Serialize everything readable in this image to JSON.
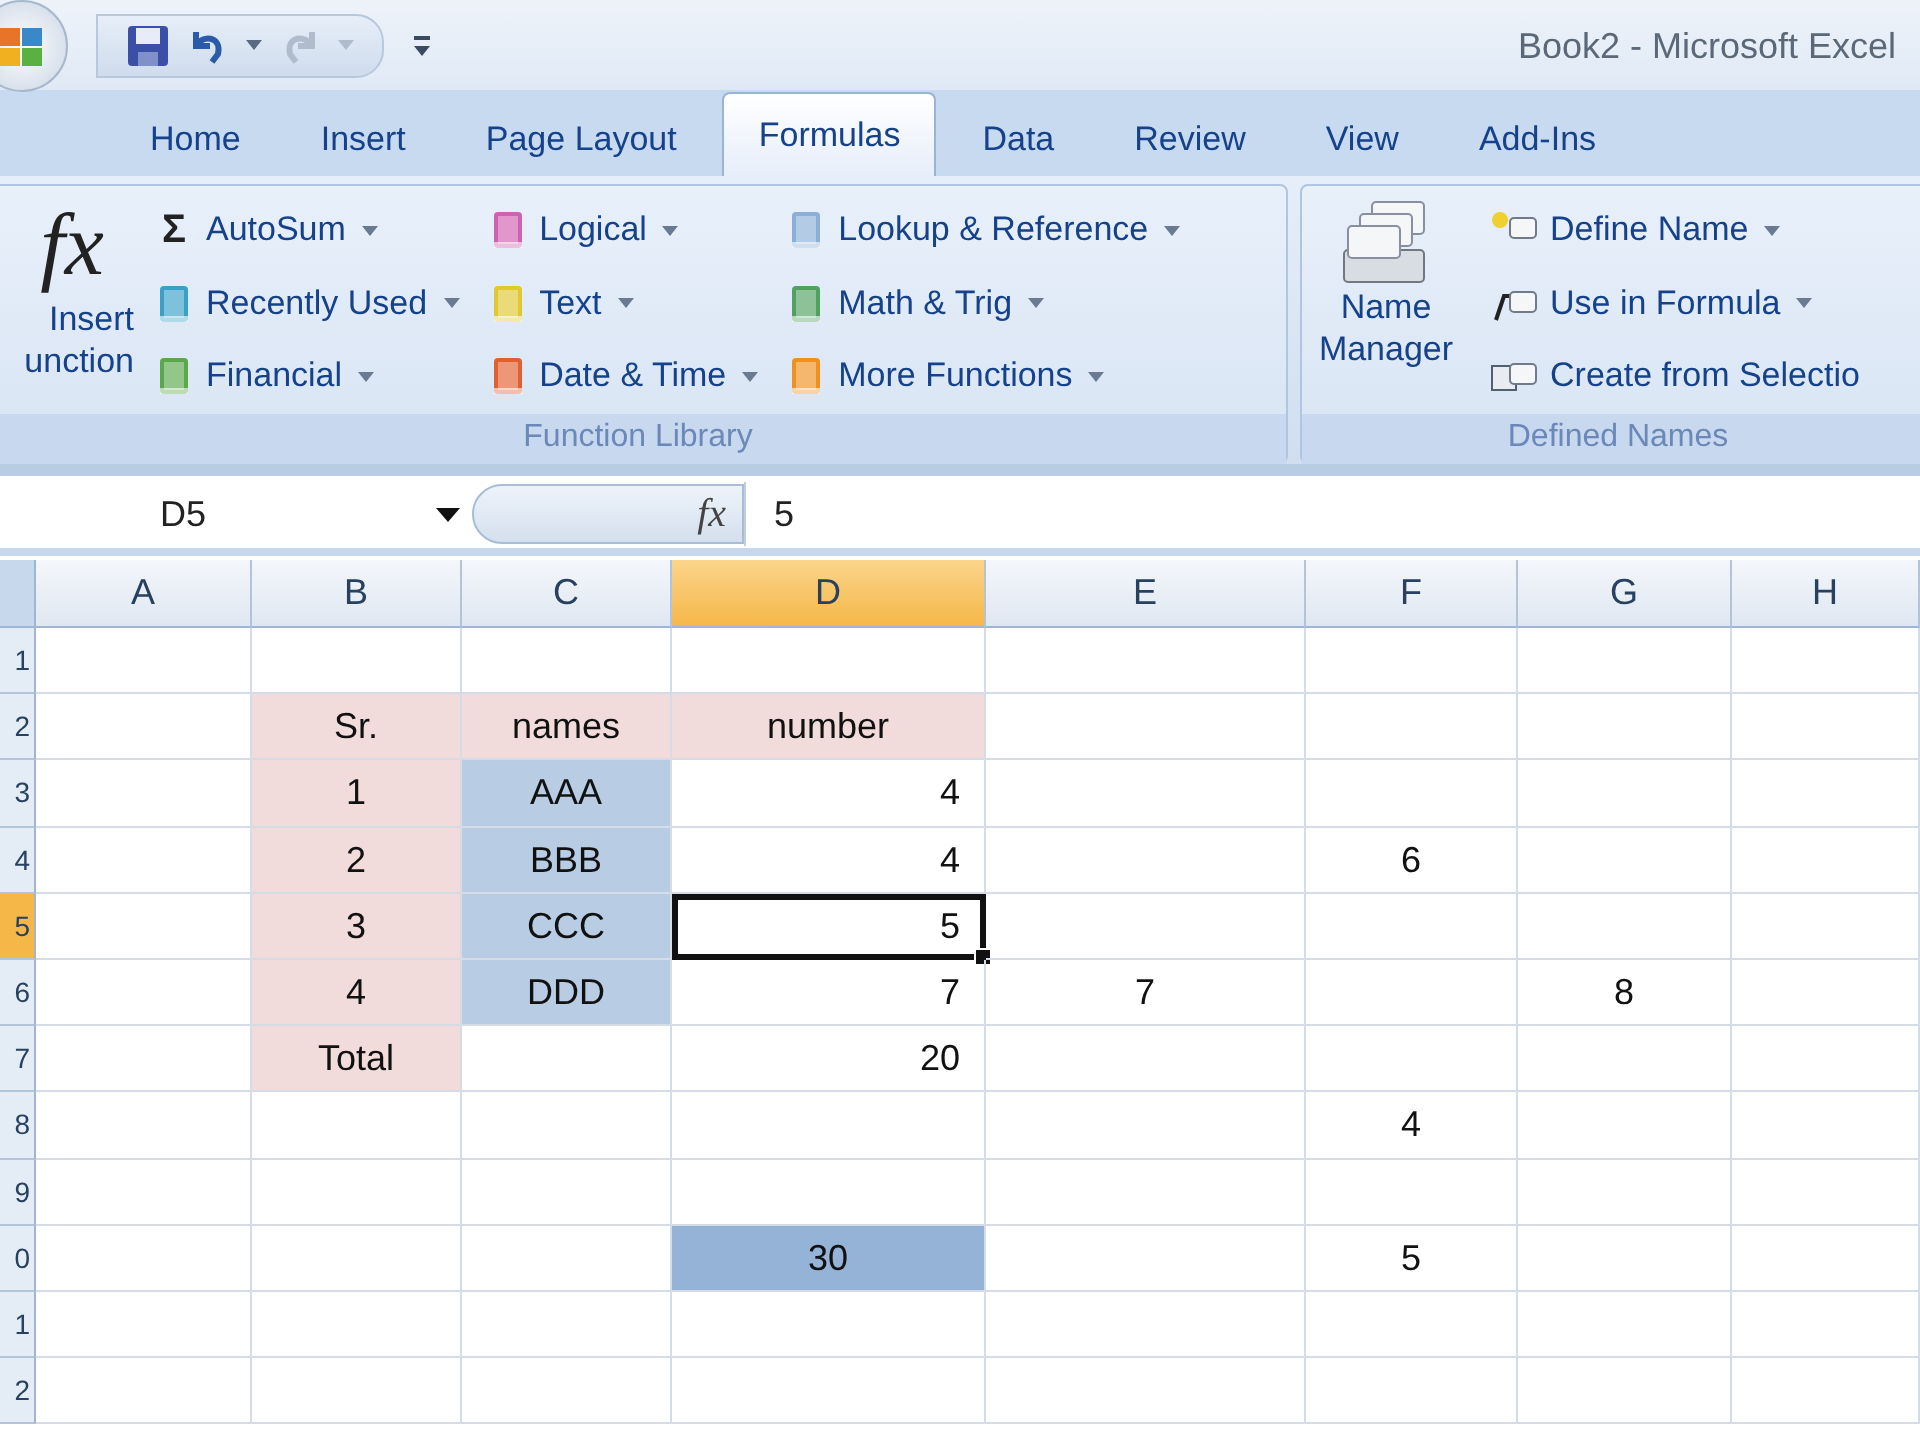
{
  "window": {
    "title": "Book2  -  Microsoft Excel"
  },
  "quick_access": {
    "redo_disabled": true
  },
  "tabs": [
    {
      "label": "Home",
      "selected": false
    },
    {
      "label": "Insert",
      "selected": false
    },
    {
      "label": "Page Layout",
      "selected": false
    },
    {
      "label": "Formulas",
      "selected": true
    },
    {
      "label": "Data",
      "selected": false
    },
    {
      "label": "Review",
      "selected": false
    },
    {
      "label": "View",
      "selected": false
    },
    {
      "label": "Add-Ins",
      "selected": false
    }
  ],
  "function_library": {
    "label": "Function Library",
    "insert_function": {
      "glyph": "fx",
      "label_lines": [
        "Insert",
        "unction"
      ]
    },
    "columns": [
      [
        {
          "glyph": "Σ",
          "label": "AutoSum",
          "dropdown": true
        },
        {
          "label": "Recently Used",
          "dropdown": true
        },
        {
          "label": "Financial",
          "dropdown": true
        }
      ],
      [
        {
          "label": "Logical",
          "dropdown": true
        },
        {
          "label": "Text",
          "dropdown": true
        },
        {
          "label": "Date & Time",
          "dropdown": true
        }
      ],
      [
        {
          "label": "Lookup & Reference",
          "dropdown": true
        },
        {
          "label": "Math & Trig",
          "dropdown": true
        },
        {
          "label": "More Functions",
          "dropdown": true
        }
      ]
    ]
  },
  "defined_names": {
    "label": "Defined Names",
    "name_manager": {
      "label_lines": [
        "Name",
        "Manager"
      ]
    },
    "items": [
      {
        "label": "Define Name",
        "dropdown": true
      },
      {
        "label": "Use in Formula",
        "dropdown": true
      },
      {
        "label": "Create from Selectio",
        "dropdown": false
      }
    ]
  },
  "formula_bar": {
    "name_box": "D5",
    "fx": "fx",
    "value": "5"
  },
  "sheet": {
    "columns": [
      {
        "label": "A",
        "selected": false
      },
      {
        "label": "B",
        "selected": false
      },
      {
        "label": "C",
        "selected": false
      },
      {
        "label": "D",
        "selected": true
      },
      {
        "label": "E",
        "selected": false
      },
      {
        "label": "F",
        "selected": false
      },
      {
        "label": "G",
        "selected": false
      },
      {
        "label": "H",
        "selected": false
      }
    ],
    "rows": [
      {
        "number": "1",
        "selected": false,
        "cells": [
          {
            "selected": false
          },
          {
            "selected": false
          },
          {
            "selected": false
          },
          {
            "selected": false
          },
          {
            "selected": false
          },
          {
            "selected": false
          },
          {
            "selected": false
          },
          {
            "selected": false
          }
        ]
      },
      {
        "number": "2",
        "selected": false,
        "cells": [
          {
            "selected": false
          },
          {
            "text": "Sr.",
            "color": "#f2dcdb",
            "selected": false
          },
          {
            "text": "names",
            "color": "#f2dcdb",
            "selected": false
          },
          {
            "text": "number",
            "color": "#f2dcdb",
            "selected": false
          },
          {
            "selected": false
          },
          {
            "selected": false
          },
          {
            "selected": false
          },
          {
            "selected": false
          }
        ]
      },
      {
        "number": "3",
        "selected": false,
        "cells": [
          {
            "selected": false
          },
          {
            "text": "1",
            "color": "#f2dcdb",
            "selected": false
          },
          {
            "text": "AAA",
            "color": "#b8cce4",
            "selected": false
          },
          {
            "text": "4",
            "kind": "number",
            "selected": false
          },
          {
            "selected": false
          },
          {
            "selected": false
          },
          {
            "selected": false
          },
          {
            "selected": false
          }
        ]
      },
      {
        "number": "4",
        "selected": false,
        "cells": [
          {
            "selected": false
          },
          {
            "text": "2",
            "color": "#f2dcdb",
            "selected": false
          },
          {
            "text": "BBB",
            "color": "#b8cce4",
            "selected": false
          },
          {
            "text": "4",
            "kind": "number",
            "selected": false
          },
          {
            "selected": false
          },
          {
            "text": "6",
            "selected": false
          },
          {
            "selected": false
          },
          {
            "selected": false
          }
        ]
      },
      {
        "number": "5",
        "selected": true,
        "cells": [
          {
            "selected": false
          },
          {
            "text": "3",
            "color": "#f2dcdb",
            "selected": false
          },
          {
            "text": "CCC",
            "color": "#b8cce4",
            "selected": false
          },
          {
            "text": "5",
            "kind": "number",
            "selected": true
          },
          {
            "selected": false
          },
          {
            "selected": false
          },
          {
            "selected": false
          },
          {
            "selected": false
          }
        ]
      },
      {
        "number": "6",
        "selected": false,
        "cells": [
          {
            "selected": false
          },
          {
            "text": "4",
            "color": "#f2dcdb",
            "selected": false
          },
          {
            "text": "DDD",
            "color": "#b8cce4",
            "selected": false
          },
          {
            "text": "7",
            "kind": "number",
            "selected": false
          },
          {
            "text": "7",
            "selected": false
          },
          {
            "selected": false
          },
          {
            "text": "8",
            "selected": false
          },
          {
            "selected": false
          }
        ]
      },
      {
        "number": "7",
        "selected": false,
        "cells": [
          {
            "selected": false
          },
          {
            "text": "Total",
            "color": "#f2dcdb",
            "selected": false
          },
          {
            "selected": false
          },
          {
            "text": "20",
            "kind": "number",
            "selected": false
          },
          {
            "selected": false
          },
          {
            "selected": false
          },
          {
            "selected": false
          },
          {
            "selected": false
          }
        ]
      },
      {
        "number": "8",
        "selected": false,
        "cells": [
          {
            "selected": false
          },
          {
            "selected": false
          },
          {
            "selected": false
          },
          {
            "selected": false
          },
          {
            "selected": false
          },
          {
            "text": "4",
            "selected": false
          },
          {
            "selected": false
          },
          {
            "selected": false
          }
        ]
      },
      {
        "number": "9",
        "selected": false,
        "cells": [
          {
            "selected": false
          },
          {
            "selected": false
          },
          {
            "selected": false
          },
          {
            "selected": false
          },
          {
            "selected": false
          },
          {
            "selected": false
          },
          {
            "selected": false
          },
          {
            "selected": false
          }
        ]
      },
      {
        "number": "0",
        "selected": false,
        "cells": [
          {
            "selected": false
          },
          {
            "selected": false
          },
          {
            "selected": false
          },
          {
            "text": "30",
            "color": "#95b3d7",
            "selected": false
          },
          {
            "selected": false
          },
          {
            "text": "5",
            "selected": false
          },
          {
            "selected": false
          },
          {
            "selected": false
          }
        ]
      },
      {
        "number": "1",
        "selected": false,
        "cells": [
          {
            "selected": false
          },
          {
            "selected": false
          },
          {
            "selected": false
          },
          {
            "selected": false
          },
          {
            "selected": false
          },
          {
            "selected": false
          },
          {
            "selected": false
          },
          {
            "selected": false
          }
        ]
      },
      {
        "number": "2",
        "selected": false,
        "cells": [
          {
            "selected": false
          },
          {
            "selected": false
          },
          {
            "selected": false
          },
          {
            "selected": false
          },
          {
            "selected": false
          },
          {
            "selected": false
          },
          {
            "selected": false
          },
          {
            "selected": false
          }
        ]
      }
    ]
  }
}
